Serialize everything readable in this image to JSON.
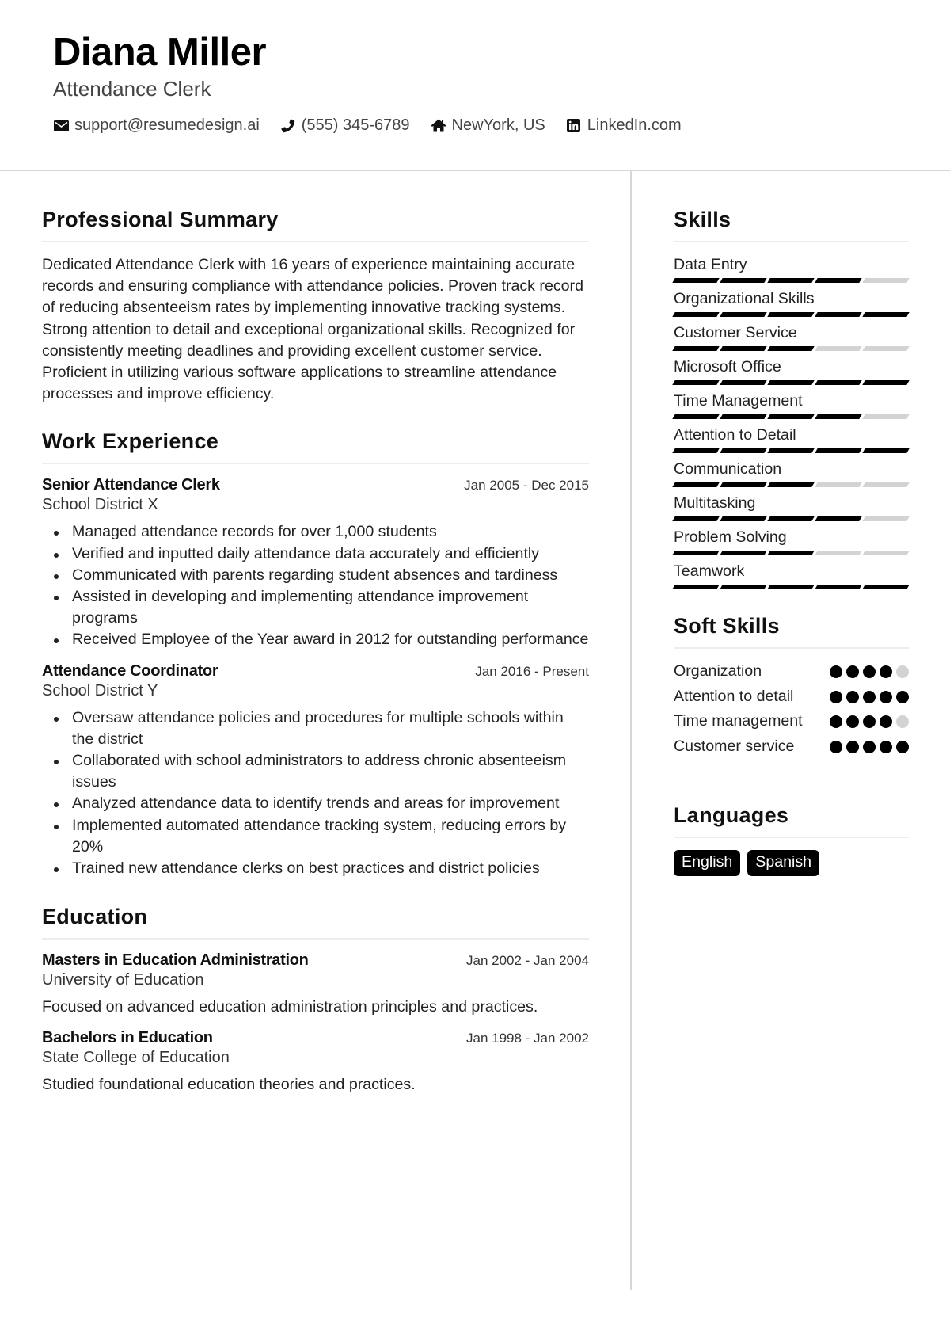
{
  "header": {
    "name": "Diana Miller",
    "title": "Attendance Clerk",
    "contacts": [
      {
        "icon": "envelope-icon",
        "text": "support@resumedesign.ai"
      },
      {
        "icon": "phone-icon",
        "text": "(555) 345-6789"
      },
      {
        "icon": "home-icon",
        "text": "NewYork, US"
      },
      {
        "icon": "linkedin-icon",
        "text": "LinkedIn.com"
      }
    ]
  },
  "summary": {
    "title": "Professional Summary",
    "text": "Dedicated Attendance Clerk with 16 years of experience maintaining accurate records and ensuring compliance with attendance policies. Proven track record of reducing absenteeism rates by implementing innovative tracking systems. Strong attention to detail and exceptional organizational skills. Recognized for consistently meeting deadlines and providing excellent customer service. Proficient in utilizing various software applications to streamline attendance processes and improve efficiency."
  },
  "experience": {
    "title": "Work Experience",
    "jobs": [
      {
        "title": "Senior Attendance Clerk",
        "org": "School District X",
        "date": "Jan 2005 - Dec 2015",
        "bullets": [
          "Managed attendance records for over 1,000 students",
          "Verified and inputted daily attendance data accurately and efficiently",
          "Communicated with parents regarding student absences and tardiness",
          "Assisted in developing and implementing attendance improvement programs",
          "Received Employee of the Year award in 2012 for outstanding performance"
        ]
      },
      {
        "title": "Attendance Coordinator",
        "org": "School District Y",
        "date": "Jan 2016 - Present",
        "bullets": [
          "Oversaw attendance policies and procedures for multiple schools within the district",
          "Collaborated with school administrators to address chronic absenteeism issues",
          "Analyzed attendance data to identify trends and areas for improvement",
          "Implemented automated attendance tracking system, reducing errors by 20%",
          "Trained new attendance clerks on best practices and district policies"
        ]
      }
    ]
  },
  "education": {
    "title": "Education",
    "items": [
      {
        "degree": "Masters in Education Administration",
        "school": "University of Education",
        "date": "Jan 2002 - Jan 2004",
        "desc": "Focused on advanced education administration principles and practices."
      },
      {
        "degree": "Bachelors in Education",
        "school": "State College of Education",
        "date": "Jan 1998 - Jan 2002",
        "desc": "Studied foundational education theories and practices."
      }
    ]
  },
  "skills": {
    "title": "Skills",
    "max": 5,
    "items": [
      {
        "name": "Data Entry",
        "level": 4
      },
      {
        "name": "Organizational Skills",
        "level": 5
      },
      {
        "name": "Customer Service",
        "level": 3
      },
      {
        "name": "Microsoft Office",
        "level": 5
      },
      {
        "name": "Time Management",
        "level": 4
      },
      {
        "name": "Attention to Detail",
        "level": 5
      },
      {
        "name": "Communication",
        "level": 3
      },
      {
        "name": "Multitasking",
        "level": 4
      },
      {
        "name": "Problem Solving",
        "level": 3
      },
      {
        "name": "Teamwork",
        "level": 5
      }
    ]
  },
  "soft_skills": {
    "title": "Soft Skills",
    "max": 5,
    "items": [
      {
        "name": "Organization",
        "level": 4
      },
      {
        "name": "Attention to detail",
        "level": 5
      },
      {
        "name": "Time management",
        "level": 4
      },
      {
        "name": "Customer service",
        "level": 5
      }
    ]
  },
  "languages": {
    "title": "Languages",
    "items": [
      "English",
      "Spanish"
    ]
  }
}
